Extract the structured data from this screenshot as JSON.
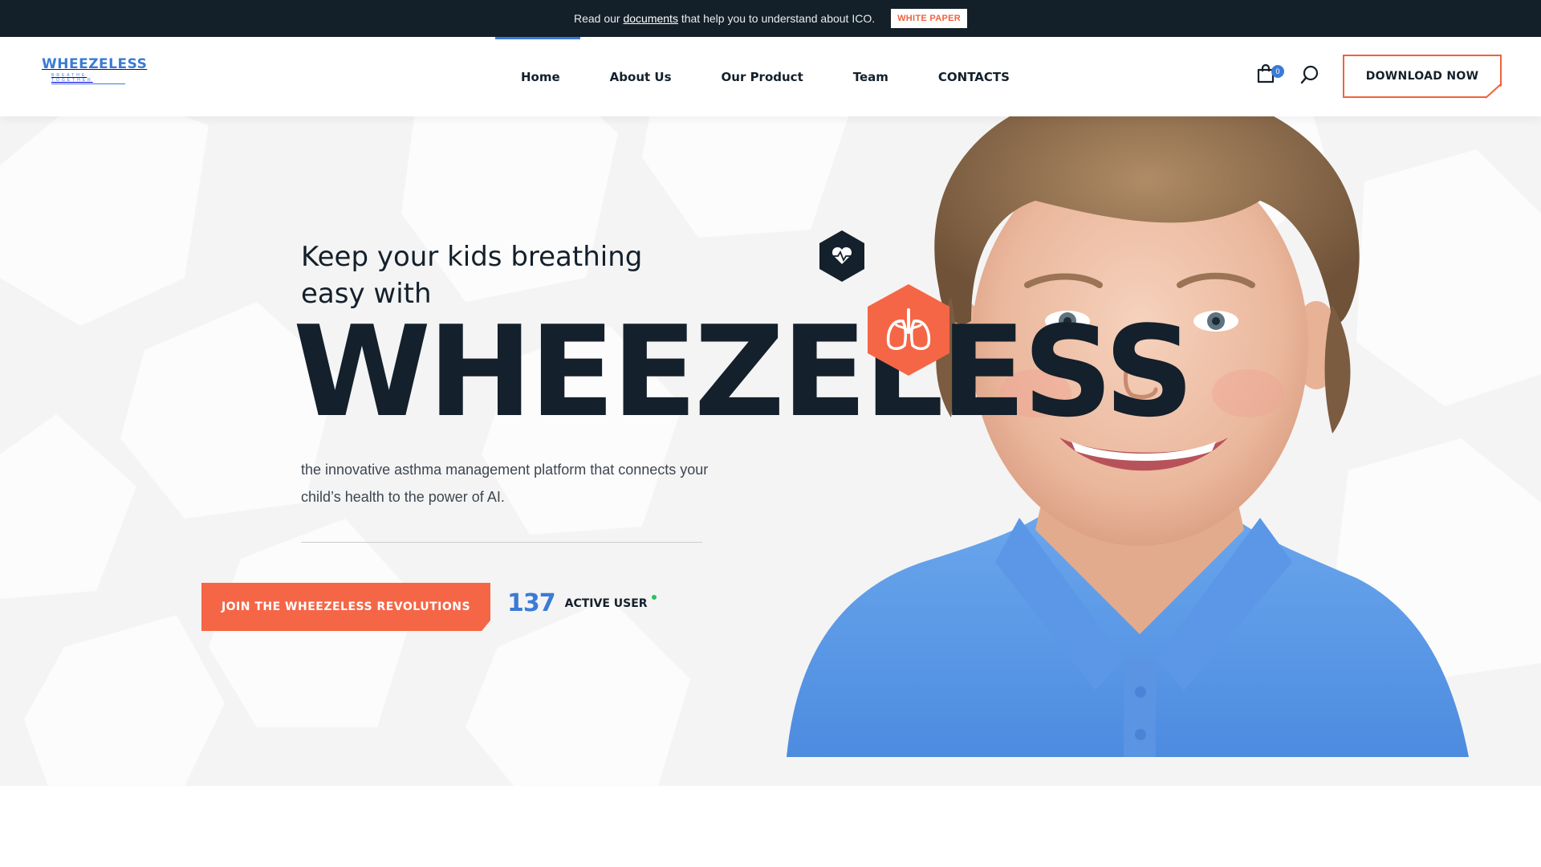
{
  "topbar": {
    "text_before": "Read our ",
    "link": "documents",
    "text_after": " that help you to understand about ICO.",
    "button": "WHITE PAPER"
  },
  "header": {
    "logo": "WHEEZELESS",
    "logo_tagline": "BREATHE TOGETHER",
    "nav": [
      {
        "label": "Home",
        "active": true
      },
      {
        "label": "About Us"
      },
      {
        "label": "Our Product"
      },
      {
        "label": "Team"
      },
      {
        "label": "CONTACTS"
      }
    ],
    "cart_count": "0",
    "download_button": "DOWNLOAD NOW",
    "icons": [
      "shopping-bag-icon",
      "search-icon"
    ]
  },
  "hero": {
    "kicker": "Keep your kids breathing easy with",
    "bigword": "WHEEZELESS",
    "description": "the innovative asthma management platform that connects your child’s health to the power of AI.",
    "cta": "JOIN THE WHEEZELESS REVOLUTIONS",
    "active_users_count": "137",
    "active_users_label": "ACTIVE USER",
    "icons": [
      "heart-pulse-icon",
      "lungs-icon"
    ]
  },
  "colors": {
    "dark": "#14202b",
    "accent": "#f56647",
    "brand_blue": "#3a7bd5",
    "online": "#22c55e",
    "hero_bg": "#f4f4f4"
  }
}
